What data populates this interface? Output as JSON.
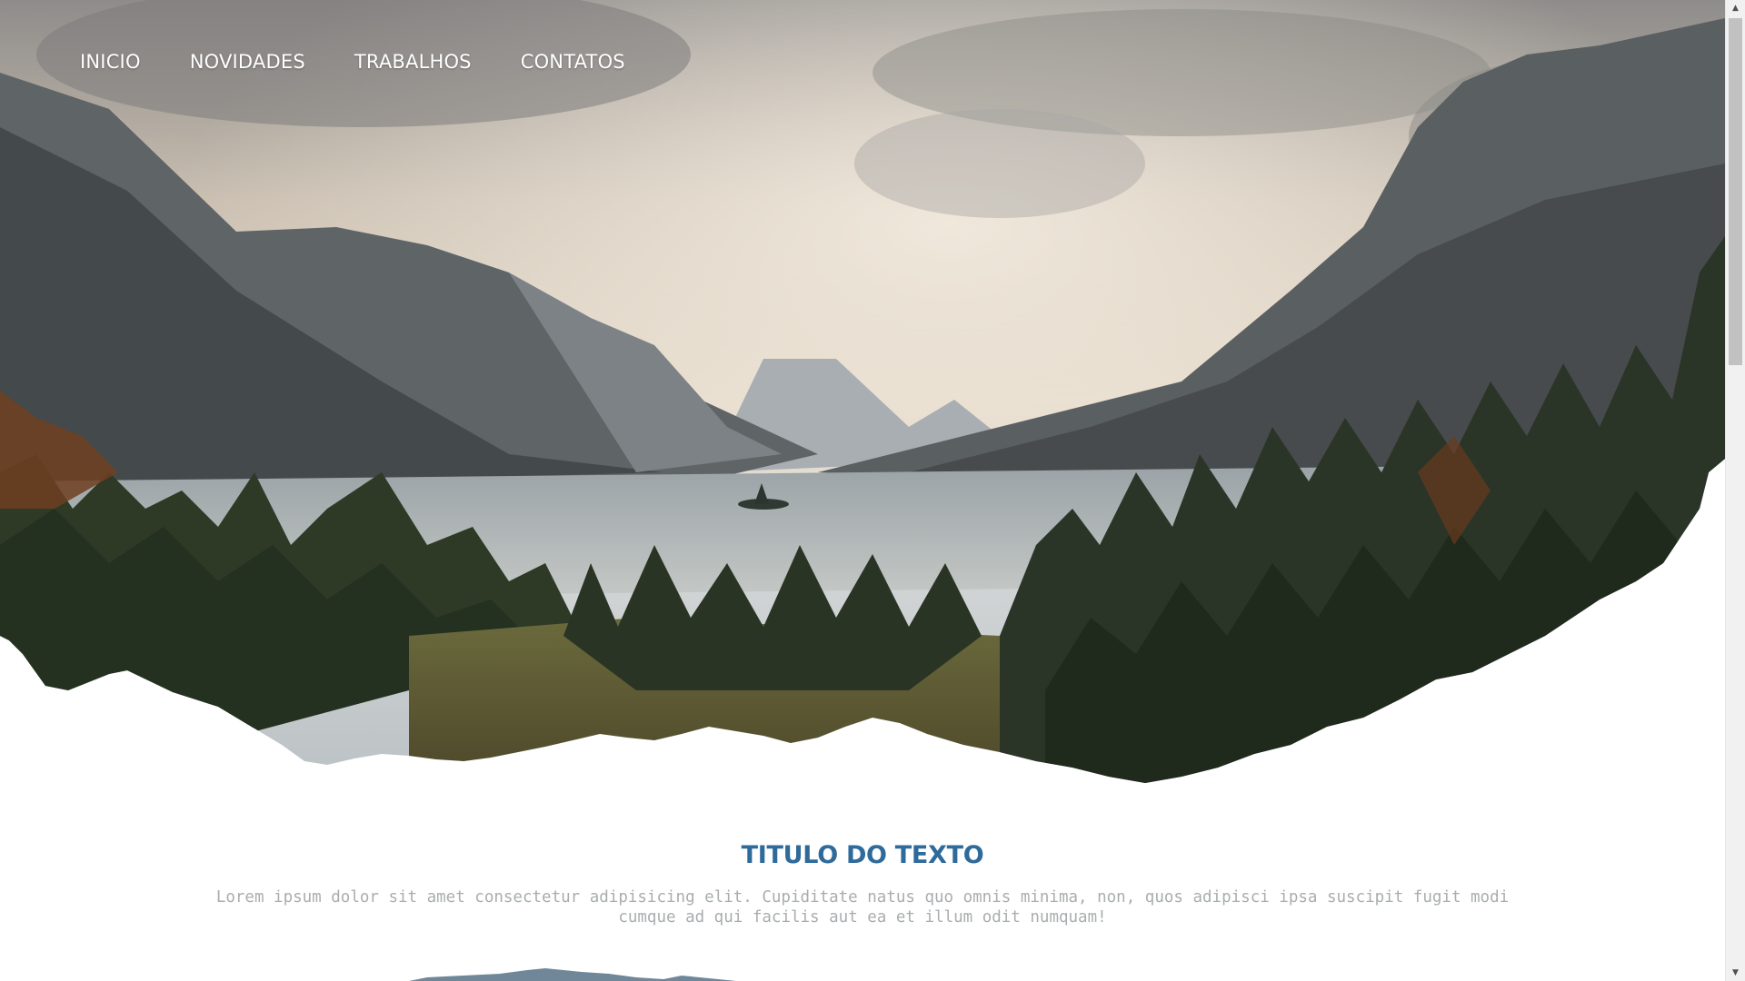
{
  "nav": {
    "items": [
      {
        "label": "INICIO"
      },
      {
        "label": "NOVIDADES"
      },
      {
        "label": "TRABALHOS"
      },
      {
        "label": "CONTATOS"
      }
    ]
  },
  "content": {
    "title": "TITULO DO TEXTO",
    "body": "Lorem ipsum dolor sit amet consectetur adipisicing elit. Cupiditate natus quo omnis minima, non, quos adipisci ipsa suscipit fugit modi cumque ad qui facilis aut ea et illum odit numquam!"
  },
  "colors": {
    "title": "#2e6a9a",
    "body_text": "#a9adaf",
    "nav_text": "#ffffff"
  },
  "scrollbar": {
    "arrow_up": "▲",
    "arrow_down": "▼"
  }
}
